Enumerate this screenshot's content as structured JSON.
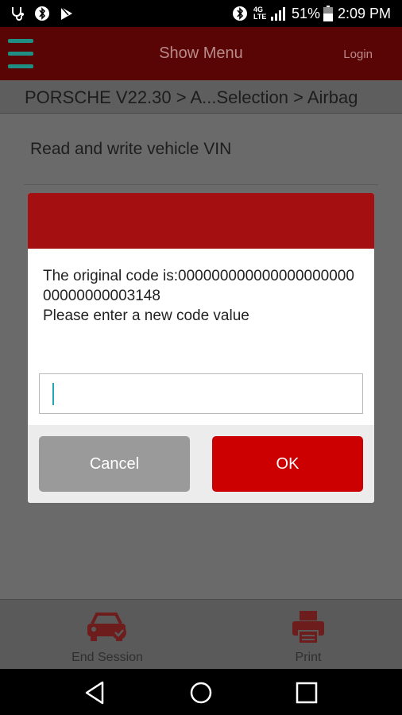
{
  "status_bar": {
    "icons": [
      "stethoscope-icon",
      "bluetooth-icon",
      "play-store-icon",
      "bluetooth-icon",
      "4g-lte-icon",
      "signal-icon",
      "battery-icon"
    ],
    "network": "4G LTE",
    "battery": "51%",
    "time": "2:09 PM"
  },
  "header": {
    "title": "Show Menu",
    "login": "Login"
  },
  "breadcrumb": "PORSCHE V22.30 > A...Selection > Airbag",
  "content": {
    "item_label": "Read and write vehicle VIN"
  },
  "dialog": {
    "line1": "The original code is:00000000000000000000000000000003148",
    "line2": "Please enter a new code value",
    "input_value": "",
    "cancel_label": "Cancel",
    "ok_label": "OK"
  },
  "toolbar": {
    "end_session_label": "End Session",
    "print_label": "Print"
  },
  "colors": {
    "header_bg": "#5a0505",
    "dialog_header": "#a41011",
    "ok_button": "#cc0000",
    "cancel_button": "#9a9a9a",
    "menu_icon": "#1f8f84"
  }
}
